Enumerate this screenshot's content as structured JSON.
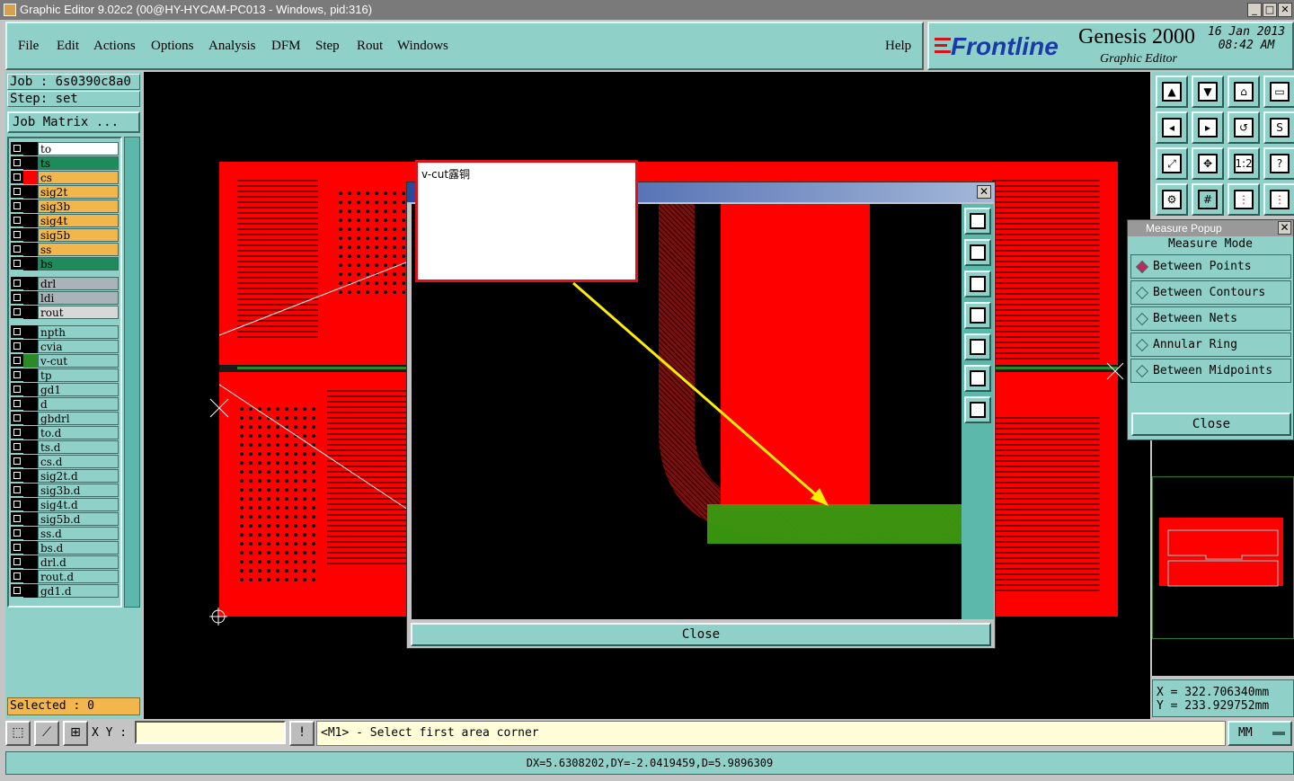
{
  "window": {
    "title": "Graphic Editor 9.02c2 (00@HY-HYCAM-PC013 - Windows, pid:316)",
    "controls": [
      "_",
      "□",
      "✕"
    ]
  },
  "menu": {
    "items": [
      "File",
      "Edit",
      "Actions",
      "Options",
      "Analysis",
      "DFM",
      "Step",
      "Rout",
      "Windows"
    ],
    "help": "Help"
  },
  "logo": {
    "brand": "Frontline",
    "product": "Genesis 2000",
    "subtitle": "Graphic Editor",
    "date": "16 Jan 2013",
    "time": "08:42 AM"
  },
  "job": {
    "job_label": "Job : 6s0390c8a0",
    "step_label": "Step: set",
    "matrix_button": "Job Matrix ..."
  },
  "layers": [
    {
      "name": "to",
      "color": "#ffffff",
      "mark": "#000000"
    },
    {
      "name": "ts",
      "color": "#1e8c5a",
      "mark": "#000000"
    },
    {
      "name": "cs",
      "color": "#f2b64c",
      "mark": "#ff0000"
    },
    {
      "name": "sig2t",
      "color": "#f2b64c",
      "mark": "#000000"
    },
    {
      "name": "sig3b",
      "color": "#f2b64c",
      "mark": "#000000"
    },
    {
      "name": "sig4t",
      "color": "#f2b64c",
      "mark": "#000000"
    },
    {
      "name": "sig5b",
      "color": "#f2b64c",
      "mark": "#000000"
    },
    {
      "name": "ss",
      "color": "#f2b64c",
      "mark": "#000000"
    },
    {
      "name": "bs",
      "color": "#1e8c5a",
      "mark": "#000000"
    },
    {
      "name": "drl",
      "color": "#a8b4b8",
      "mark": "#000000"
    },
    {
      "name": "ldi",
      "color": "#a8b4b8",
      "mark": "#000000"
    },
    {
      "name": "rout",
      "color": "#d8d8d8",
      "mark": "#000000"
    },
    {
      "name": "npth",
      "color": "#8fd0c8",
      "mark": "#000000"
    },
    {
      "name": "cvia",
      "color": "#8fd0c8",
      "mark": "#000000"
    },
    {
      "name": "v-cut",
      "color": "#8fd0c8",
      "mark": "#2a8a2a"
    },
    {
      "name": "tp",
      "color": "#8fd0c8",
      "mark": "#000000"
    },
    {
      "name": "gd1",
      "color": "#8fd0c8",
      "mark": "#000000"
    },
    {
      "name": "d",
      "color": "#8fd0c8",
      "mark": "#000000"
    },
    {
      "name": "gbdrl",
      "color": "#8fd0c8",
      "mark": "#000000"
    },
    {
      "name": "to.d",
      "color": "#8fd0c8",
      "mark": "#000000"
    },
    {
      "name": "ts.d",
      "color": "#8fd0c8",
      "mark": "#000000"
    },
    {
      "name": "cs.d",
      "color": "#8fd0c8",
      "mark": "#000000"
    },
    {
      "name": "sig2t.d",
      "color": "#8fd0c8",
      "mark": "#000000"
    },
    {
      "name": "sig3b.d",
      "color": "#8fd0c8",
      "mark": "#000000"
    },
    {
      "name": "sig4t.d",
      "color": "#8fd0c8",
      "mark": "#000000"
    },
    {
      "name": "sig5b.d",
      "color": "#8fd0c8",
      "mark": "#000000"
    },
    {
      "name": "ss.d",
      "color": "#8fd0c8",
      "mark": "#000000"
    },
    {
      "name": "bs.d",
      "color": "#8fd0c8",
      "mark": "#000000"
    },
    {
      "name": "drl.d",
      "color": "#8fd0c8",
      "mark": "#000000"
    },
    {
      "name": "rout.d",
      "color": "#8fd0c8",
      "mark": "#000000"
    },
    {
      "name": "gd1.d",
      "color": "#8fd0c8",
      "mark": "#000000"
    }
  ],
  "selected": "Selected : 0",
  "toolbar": {
    "buttons": [
      "layer-up-icon",
      "layer-down-icon",
      "home-icon",
      "panel-icon",
      "left-icon",
      "right-icon",
      "undo-icon",
      "snap-icon",
      "fit-icon",
      "center-icon",
      "1:2",
      "?",
      "tools-icon",
      "grid-icon",
      "net-icon",
      "highlight-icon"
    ],
    "ratio_label": "1:2",
    "help_label": "?"
  },
  "measure": {
    "title": "Measure Popup",
    "mode_label": "Measure Mode",
    "options": [
      "Between Points",
      "Between Contours",
      "Between Nets",
      "Annular Ring",
      "Between Midpoints"
    ],
    "selected": "Between Points",
    "close": "Close"
  },
  "coords": {
    "x": "X = 322.706340mm",
    "y": "Y = 233.929752mm"
  },
  "zoom": {
    "close": "Close"
  },
  "note": {
    "text": "v-cut露铜"
  },
  "status": {
    "xy_label": "X Y :",
    "xy_value": "",
    "prompt": "<M1> - Select first area corner",
    "units": "MM",
    "info_button": "!"
  },
  "bottom": {
    "text": "DX=5.6308202,DY=-2.0419459,D=5.9896309"
  }
}
